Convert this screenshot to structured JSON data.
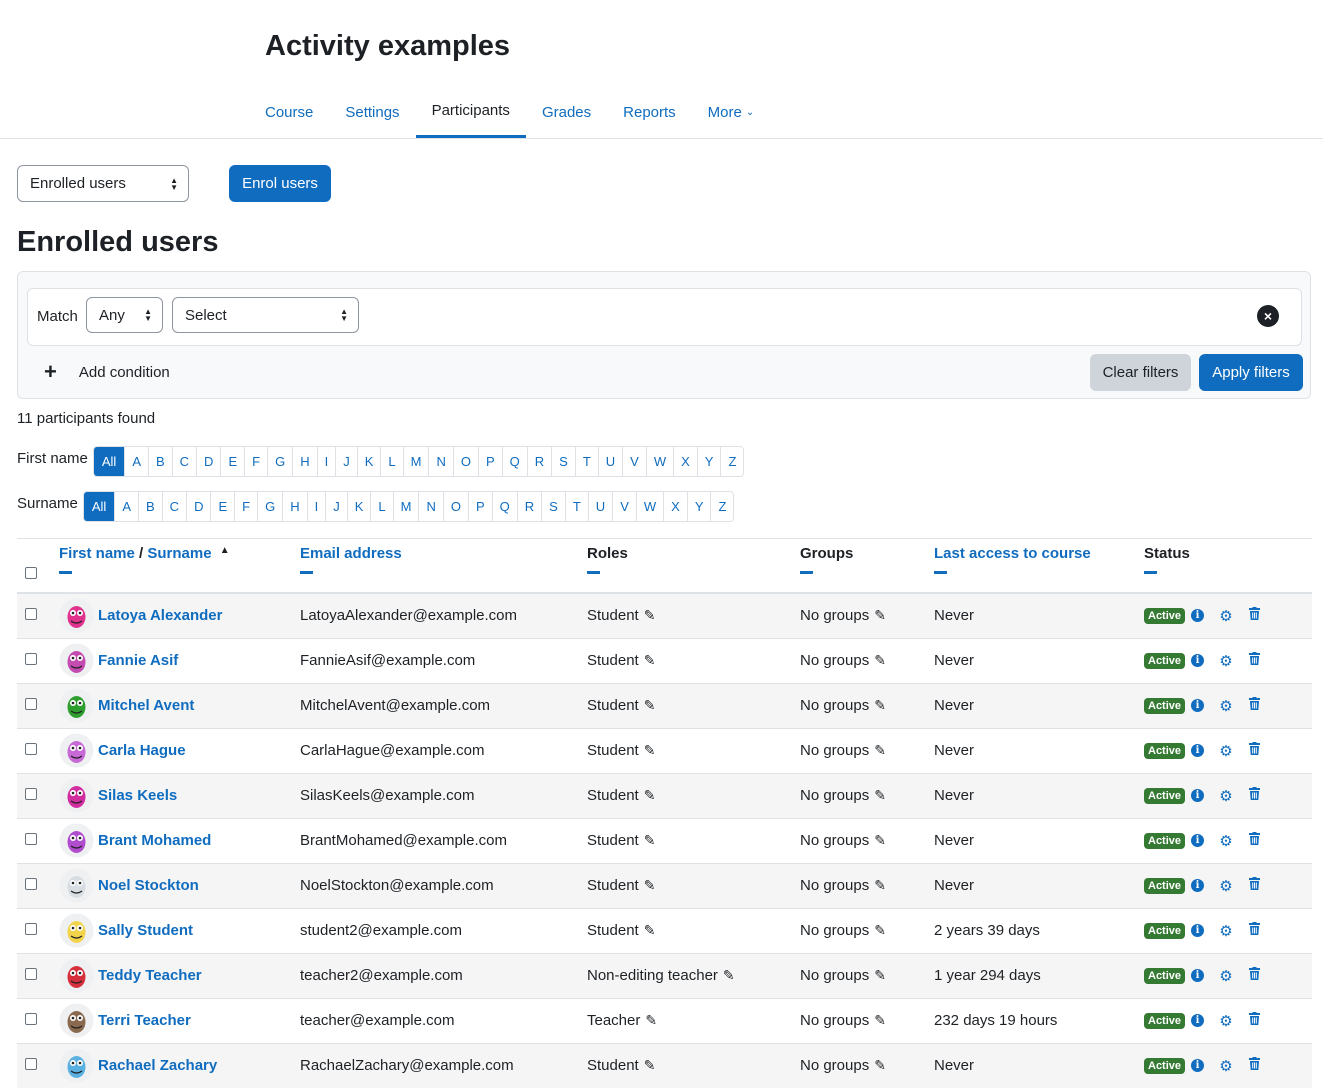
{
  "course": {
    "title": "Activity examples"
  },
  "nav": {
    "tabs": [
      {
        "label": "Course"
      },
      {
        "label": "Settings"
      },
      {
        "label": "Participants"
      },
      {
        "label": "Grades"
      },
      {
        "label": "Reports"
      },
      {
        "label": "More"
      }
    ],
    "active": "Participants"
  },
  "toolbar": {
    "view_select": "Enrolled users",
    "enrol_button": "Enrol users"
  },
  "page_title": "Enrolled users",
  "filters": {
    "match_label": "Match",
    "match_value": "Any",
    "type_value": "Select",
    "add_condition": "Add condition",
    "clear": "Clear filters",
    "apply": "Apply filters"
  },
  "participants_count": "11 participants found",
  "initials": {
    "firstname_label": "First name",
    "surname_label": "Surname",
    "all_label": "All",
    "letters": [
      "A",
      "B",
      "C",
      "D",
      "E",
      "F",
      "G",
      "H",
      "I",
      "J",
      "K",
      "L",
      "M",
      "N",
      "O",
      "P",
      "Q",
      "R",
      "S",
      "T",
      "U",
      "V",
      "W",
      "X",
      "Y",
      "Z"
    ]
  },
  "table": {
    "headers": {
      "firstname": "First name",
      "separator": "/",
      "surname": "Surname",
      "email": "Email address",
      "roles": "Roles",
      "groups": "Groups",
      "lastaccess": "Last access to course",
      "status": "Status"
    },
    "status_label": "Active",
    "rows": [
      {
        "name": "Latoya Alexander",
        "email": "LatoyaAlexander@example.com",
        "role": "Student",
        "groups": "No groups",
        "lastaccess": "Never"
      },
      {
        "name": "Fannie Asif",
        "email": "FannieAsif@example.com",
        "role": "Student",
        "groups": "No groups",
        "lastaccess": "Never"
      },
      {
        "name": "Mitchel Avent",
        "email": "MitchelAvent@example.com",
        "role": "Student",
        "groups": "No groups",
        "lastaccess": "Never"
      },
      {
        "name": "Carla Hague",
        "email": "CarlaHague@example.com",
        "role": "Student",
        "groups": "No groups",
        "lastaccess": "Never"
      },
      {
        "name": "Silas Keels",
        "email": "SilasKeels@example.com",
        "role": "Student",
        "groups": "No groups",
        "lastaccess": "Never"
      },
      {
        "name": "Brant Mohamed",
        "email": "BrantMohamed@example.com",
        "role": "Student",
        "groups": "No groups",
        "lastaccess": "Never"
      },
      {
        "name": "Noel Stockton",
        "email": "NoelStockton@example.com",
        "role": "Student",
        "groups": "No groups",
        "lastaccess": "Never"
      },
      {
        "name": "Sally Student",
        "email": "student2@example.com",
        "role": "Student",
        "groups": "No groups",
        "lastaccess": "2 years 39 days"
      },
      {
        "name": "Teddy Teacher",
        "email": "teacher2@example.com",
        "role": "Non-editing teacher",
        "groups": "No groups",
        "lastaccess": "1 year 294 days"
      },
      {
        "name": "Terri Teacher",
        "email": "teacher@example.com",
        "role": "Teacher",
        "groups": "No groups",
        "lastaccess": "232 days 19 hours"
      },
      {
        "name": "Rachael Zachary",
        "email": "RachaelZachary@example.com",
        "role": "Student",
        "groups": "No groups",
        "lastaccess": "Never"
      }
    ]
  },
  "colors": {
    "primary": "#0f6cbf",
    "active_badge": "#357a32",
    "avatar_colors": [
      "#e0338d",
      "#c44bb0",
      "#2e9e2e",
      "#c76ad6",
      "#d12ea0",
      "#b14ccf",
      "#d7dde3",
      "#f2d34c",
      "#d6303c",
      "#8a6a4f",
      "#5ab0e0"
    ]
  }
}
